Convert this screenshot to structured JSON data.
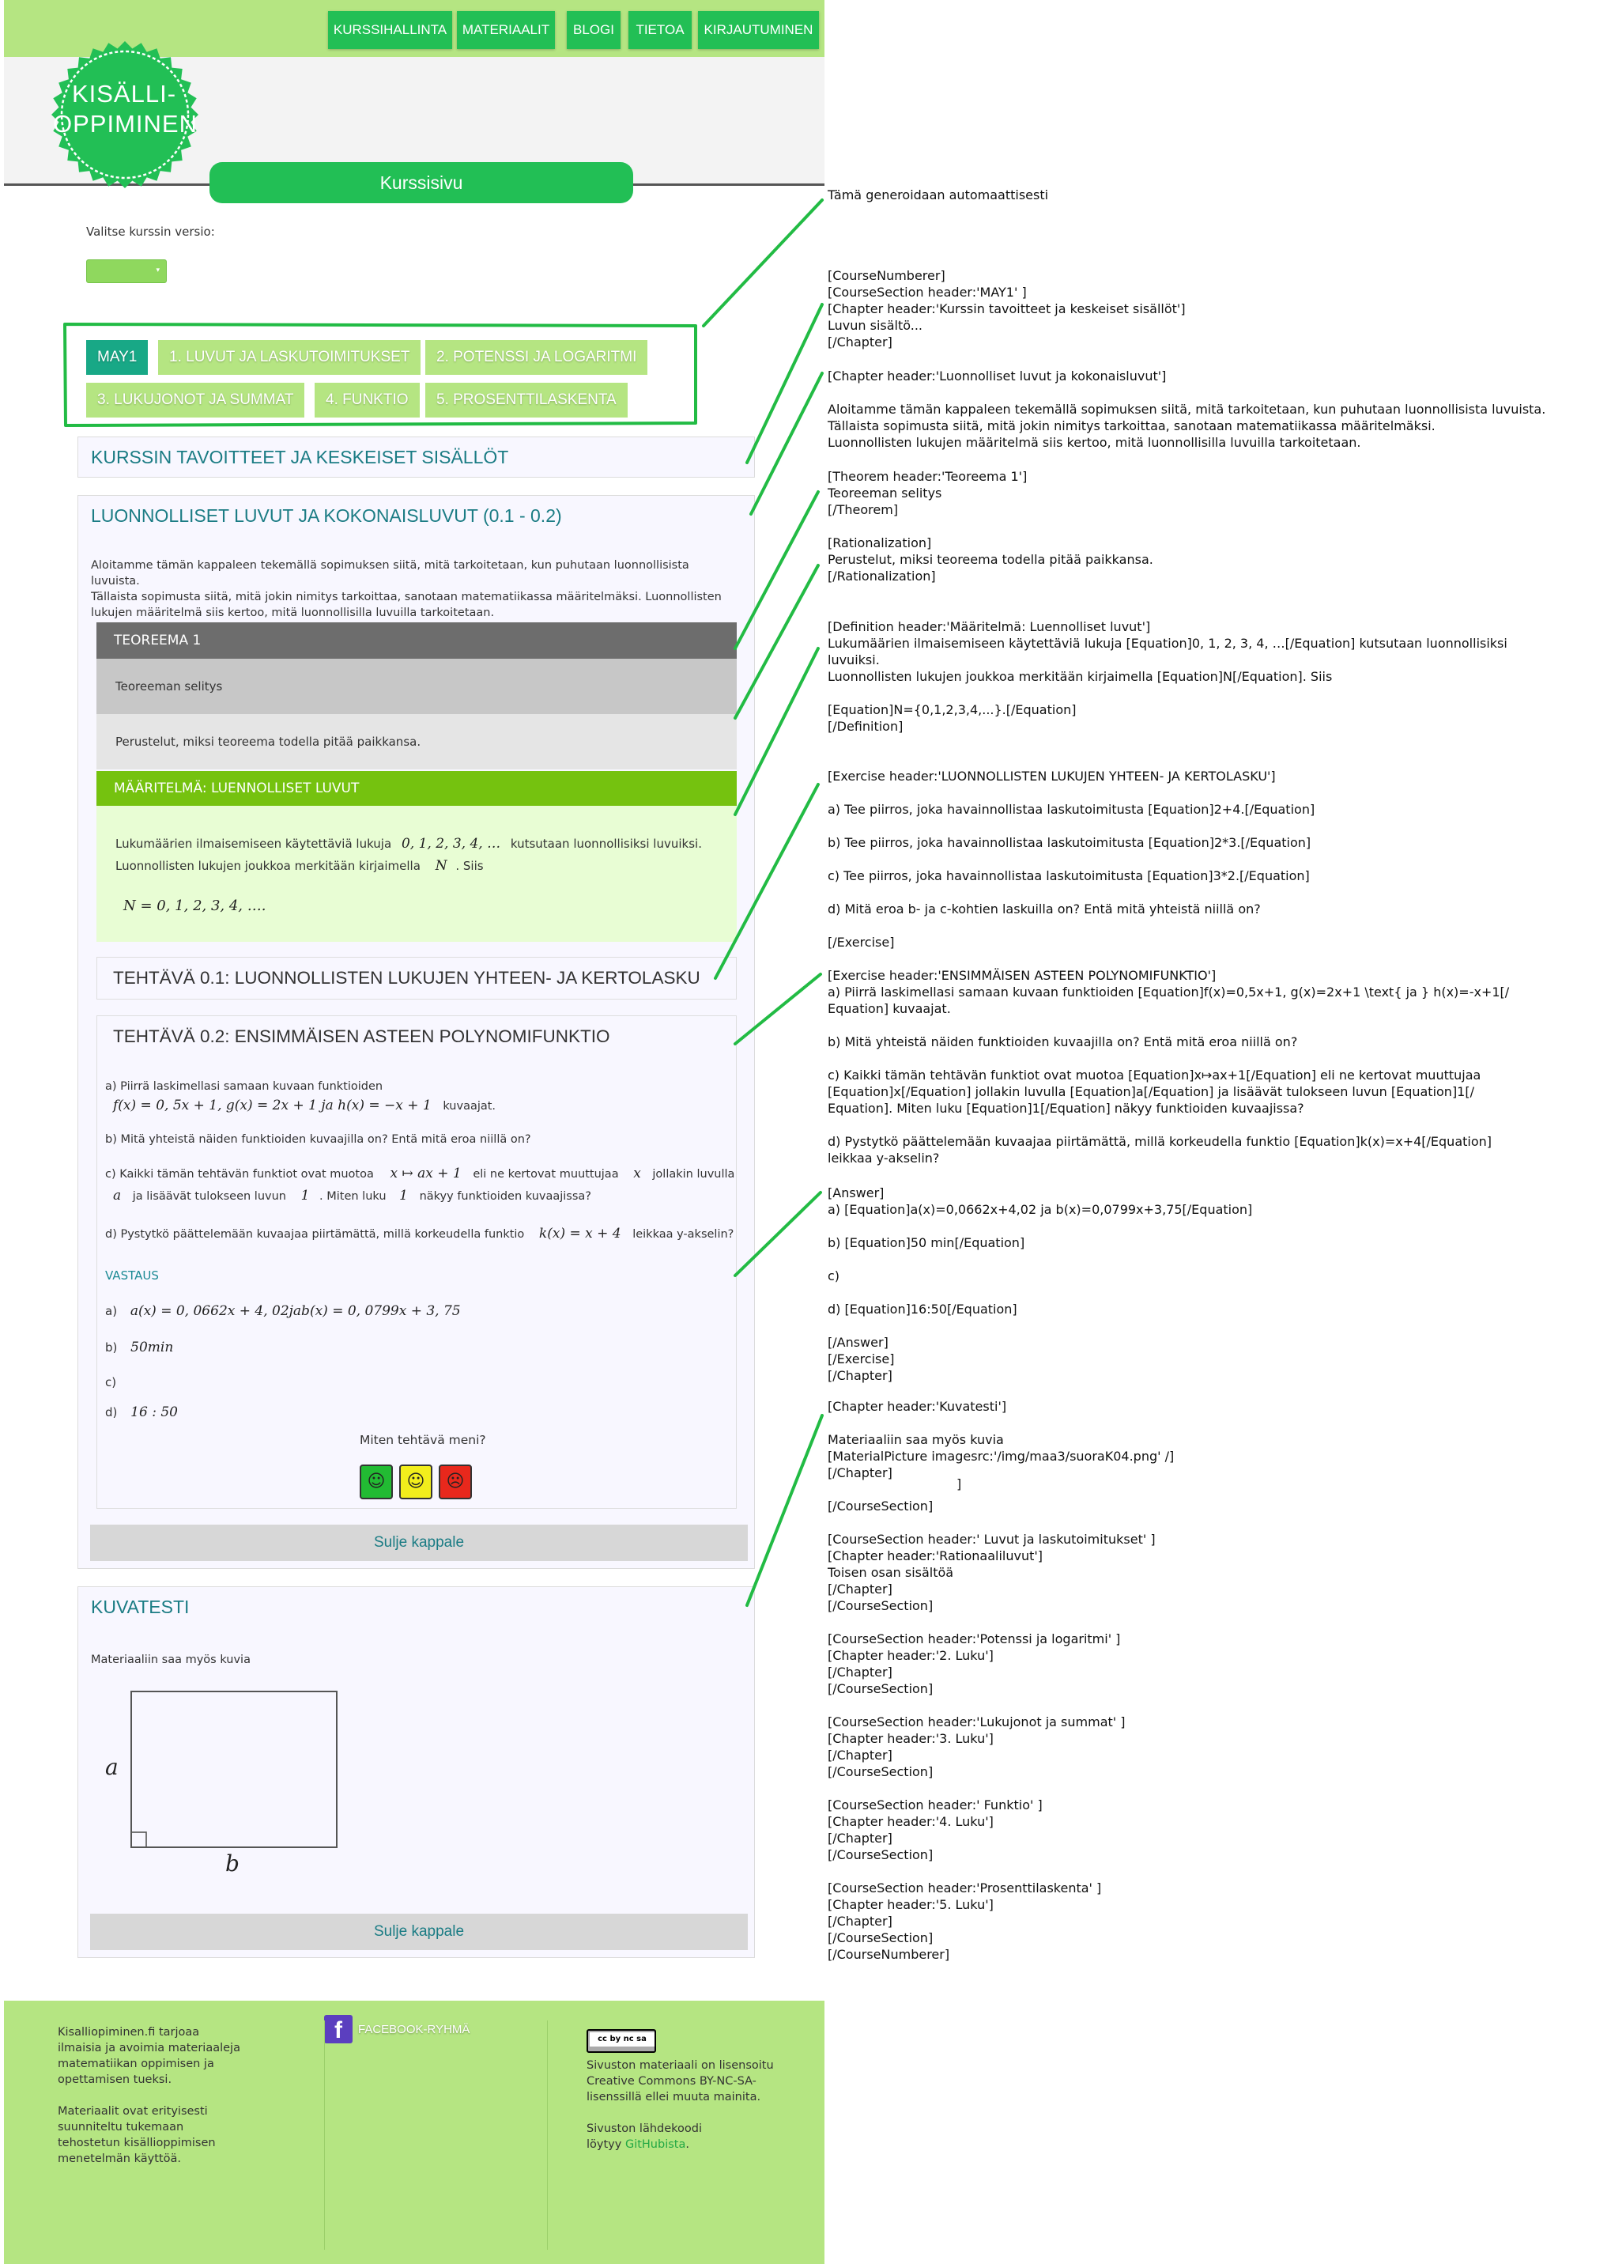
{
  "nav": {
    "items": [
      "KURSSIHALLINTA",
      "MATERIAALIT",
      "BLOGI",
      "TIETOA",
      "KIRJAUTUMINEN"
    ]
  },
  "logo": {
    "line1": "KISÄLLI-",
    "line2": "OPPIMINEN"
  },
  "page_tab": "Kurssisivu",
  "version": {
    "label": "Valitse kurssin versio:",
    "arrow": "▾"
  },
  "tabs": [
    "MAY1",
    "1. LUVUT JA LASKUTOIMITUKSET",
    "2. POTENSSI JA LOGARITMI",
    "3. LUKUJONOT JA SUMMAT",
    "4. FUNKTIO",
    "5. PROSENTTILASKENTA"
  ],
  "sections": {
    "goals_title": "KURSSIN TAVOITTEET JA KESKEISET SISÄLLÖT",
    "natural_title": "LUONNOLLISET LUVUT JA KOKONAISLUVUT (0.1 - 0.2)",
    "natural_intro": [
      "Aloitamme tämän kappaleen tekemällä sopimuksen siitä, mitä tarkoitetaan, kun puhutaan luonnollisista luvuista.",
      "Tällaista sopimusta siitä, mitä jokin nimitys tarkoittaa, sanotaan matematiikassa määritelmäksi. Luonnollisten",
      "lukujen määritelmä siis kertoo, mitä luonnollisilla luvuilla tarkoitetaan."
    ],
    "theorem": {
      "title": "TEOREEMA 1",
      "body": "Teoreeman selitys",
      "rationale": "Perustelut, miksi teoreema todella pitää paikkansa."
    },
    "definition": {
      "title": "MÄÄRITELMÄ: LUENNOLLISET LUVUT",
      "line1_pre": "Lukumäärien ilmaisemiseen käytettäviä lukuja",
      "line1_math": "0, 1, 2, 3, 4, …",
      "line1_post": "kutsutaan luonnollisiksi luvuiksi.",
      "line2_pre": "Luonnollisten lukujen joukkoa merkitään kirjaimella",
      "line2_math": "N",
      "line2_post": ". Siis",
      "formula": "N = 0, 1, 2, 3, 4, …."
    },
    "exercise1_title": "TEHTÄVÄ 0.1: LUONNOLLISTEN LUKUJEN YHTEEN- JA KERTOLASKU",
    "exercise2": {
      "title": "TEHTÄVÄ 0.2: ENSIMMÄISEN ASTEEN POLYNOMIFUNKTIO",
      "a_line1": "a) Piirrä laskimellasi samaan kuvaan funktioiden",
      "a_math": "f(x) = 0, 5x + 1, g(x) = 2x + 1 ja h(x) = −x + 1",
      "a_post": "kuvaajat.",
      "b": "b) Mitä yhteistä näiden funktioiden kuvaajilla on? Entä mitä eroa niillä on?",
      "c_pre": "c) Kaikki tämän tehtävän funktiot ovat muotoa",
      "c_math1": "x ↦ ax + 1",
      "c_mid": "eli ne kertovat muuttujaa",
      "c_math2": "x",
      "c_post": "jollakin luvulla",
      "c2_math1": "a",
      "c2_mid": "ja lisäävät tulokseen luvun",
      "c2_math2": "1",
      "c2_mid2": ". Miten luku",
      "c2_math3": "1",
      "c2_post": "näkyy funktioiden kuvaajissa?",
      "d_pre": "d) Pystytkö päättelemään kuvaajaa piirtämättä, millä korkeudella funktio",
      "d_math": "k(x) = x + 4",
      "d_post": "leikkaa y-akselin?",
      "answer_label": "VASTAUS",
      "answers": [
        {
          "label": "a)",
          "value": "a(x) = 0, 0662x + 4, 02jab(x) = 0, 0799x + 3, 75"
        },
        {
          "label": "b)",
          "value": "50min"
        },
        {
          "label": "c)",
          "value": ""
        },
        {
          "label": "d)",
          "value": "16 : 50"
        }
      ],
      "feedback_question": "Miten tehtävä meni?"
    },
    "close_label": "Sulje kappale",
    "pictures_title": "KUVATESTI",
    "pictures_intro": "Materiaaliin saa myös kuvia",
    "figure_labels": {
      "side_a": "a",
      "side_b": "b"
    }
  },
  "footer": {
    "col1_p1": [
      "Kisalliopiminen.fi tarjoaa",
      "ilmaisia ja avoimia materiaaleja",
      "matematiikan oppimisen ja",
      "opettamisen tueksi."
    ],
    "col1_p2": [
      "Materiaalit ovat erityisesti",
      "suunniteltu tukemaan",
      "tehostetun kisällioppimisen",
      "menetelmän käyttöä."
    ],
    "facebook": "FACEBOOK-RYHMÄ",
    "license_p1": [
      "Sivuston materiaali on lisensoitu",
      "Creative Commons BY-NC-SA-",
      "lisenssillä ellei muuta mainita."
    ],
    "source_p1": "Sivuston lähdekoodi",
    "source_p2_pre": "löytyy",
    "source_link": "GitHubista",
    "source_p2_post": ".",
    "cc_badge": "cc by nc sa"
  },
  "annotations": {
    "auto": "Tämä generoidaan automaattisesti",
    "block1": "[CourseNumberer]\n[CourseSection header:'MAY1' ]\n[Chapter header:'Kurssin tavoitteet ja keskeiset sisällöt']\nLuvun sisältö...\n[/Chapter]",
    "block2": "[Chapter header:'Luonnolliset luvut ja kokonaisluvut']\n\nAloitamme tämän kappaleen tekemällä sopimuksen siitä, mitä tarkoitetaan, kun puhutaan luonnollisista luvuista.\nTällaista sopimusta siitä, mitä jokin nimitys tarkoittaa, sanotaan matematiikassa määritelmäksi.\nLuonnollisten lukujen määritelmä siis kertoo, mitä luonnollisilla luvuilla tarkoitetaan.",
    "block3": "[Theorem header:'Teoreema 1']\nTeoreeman selitys\n[/Theorem]",
    "block4": "[Rationalization]\nPerustelut, miksi teoreema todella pitää paikkansa.\n[/Rationalization]",
    "block5": "[Definition header:'Määritelmä: Luennolliset luvut']\nLukumäärien ilmaisemiseen käytettäviä lukuja [Equation]0, 1, 2, 3, 4, …[/Equation] kutsutaan luonnollisiksi\nluvuiksi.\nLuonnollisten lukujen joukkoa merkitään kirjaimella [Equation]N[/Equation]. Siis\n\n[Equation]N={0,1,2,3,4,...}.[/Equation]\n[/Definition]",
    "block6": "[Exercise header:'LUONNOLLISTEN LUKUJEN YHTEEN- JA KERTOLASKU']\n\na) Tee piirros, joka havainnollistaa laskutoimitusta [Equation]2+4.[/Equation]\n\nb) Tee piirros, joka havainnollistaa laskutoimitusta [Equation]2*3.[/Equation]\n\nc) Tee piirros, joka havainnollistaa laskutoimitusta [Equation]3*2.[/Equation]\n\nd) Mitä eroa b- ja c-kohtien laskuilla on? Entä mitä yhteistä niillä on?\n\n[/Exercise]",
    "block7": "[Exercise header:'ENSIMMÄISEN ASTEEN POLYNOMIFUNKTIO']\na) Piirrä laskimellasi samaan kuvaan funktioiden [Equation]f(x)=0,5x+1, g(x)=2x+1 \\text{ ja } h(x)=-x+1[/\nEquation] kuvaajat.\n\nb) Mitä yhteistä näiden funktioiden kuvaajilla on? Entä mitä eroa niillä on?\n\nc) Kaikki tämän tehtävän funktiot ovat muotoa [Equation]x↦ax+1[/Equation] eli ne kertovat muuttujaa\n[Equation]x[/Equation] jollakin luvulla [Equation]a[/Equation] ja lisäävät tulokseen luvun [Equation]1[/\nEquation]. Miten luku [Equation]1[/Equation] näkyy funktioiden kuvaajissa?\n\nd) Pystytkö päättelemään kuvaajaa piirtämättä, millä korkeudella funktio [Equation]k(x)=x+4[/Equation]\nleikkaa y-akselin?",
    "block8": "[Answer]\na) [Equation]a(x)=0,0662x+4,02 ja b(x)=0,0799x+3,75[/Equation]\n\nb) [Equation]50 min[/Equation]\n\nc)\n\nd) [Equation]16:50[/Equation]\n\n[/Answer]\n[/Exercise]\n[/Chapter]",
    "block9": "[Chapter header:'Kuvatesti']\n\nMateriaaliin saa myös kuvia\n[MaterialPicture imagesrc:'/img/maa3/suoraK04.png' /]\n[/Chapter]",
    "bracket": "]",
    "block10": "[/CourseSection]\n\n[CourseSection header:' Luvut ja laskutoimitukset' ]\n[Chapter header:'Rationaaliluvut']\nToisen osan sisältöä\n[/Chapter]\n[/CourseSection]\n\n[CourseSection header:'Potenssi ja logaritmi' ]\n[Chapter header:'2. Luku']\n[/Chapter]\n[/CourseSection]\n\n[CourseSection header:'Lukujonot ja summat' ]\n[Chapter header:'3. Luku']\n[/Chapter]\n[/CourseSection]\n\n[CourseSection header:' Funktio' ]\n[Chapter header:'4. Luku']\n[/Chapter]\n[/CourseSection]\n\n[CourseSection header:'Prosenttilaskenta' ]\n[Chapter header:'5. Luku']\n[/Chapter]\n[/CourseSection]\n[/CourseNumberer]"
  },
  "colors": {
    "nav_green": "#22bf55",
    "light_green": "#b5e582",
    "teal_accent": "#18a886",
    "heading_teal": "#1b7c84",
    "definition_green": "#75c20f",
    "connector_green": "#22bb44"
  }
}
